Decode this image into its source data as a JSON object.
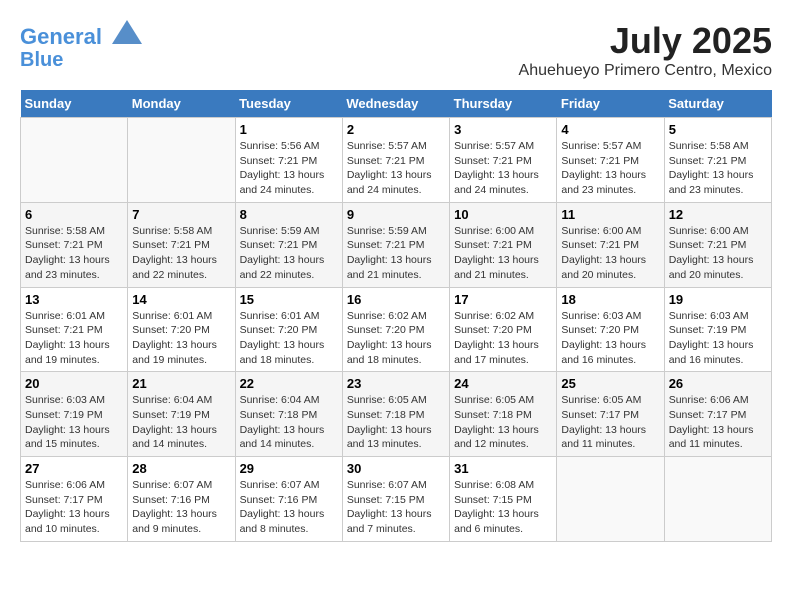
{
  "header": {
    "logo_line1": "General",
    "logo_line2": "Blue",
    "month": "July 2025",
    "location": "Ahuehueyo Primero Centro, Mexico"
  },
  "days_of_week": [
    "Sunday",
    "Monday",
    "Tuesday",
    "Wednesday",
    "Thursday",
    "Friday",
    "Saturday"
  ],
  "weeks": [
    [
      {
        "day": "",
        "info": ""
      },
      {
        "day": "",
        "info": ""
      },
      {
        "day": "1",
        "info": "Sunrise: 5:56 AM\nSunset: 7:21 PM\nDaylight: 13 hours\nand 24 minutes."
      },
      {
        "day": "2",
        "info": "Sunrise: 5:57 AM\nSunset: 7:21 PM\nDaylight: 13 hours\nand 24 minutes."
      },
      {
        "day": "3",
        "info": "Sunrise: 5:57 AM\nSunset: 7:21 PM\nDaylight: 13 hours\nand 24 minutes."
      },
      {
        "day": "4",
        "info": "Sunrise: 5:57 AM\nSunset: 7:21 PM\nDaylight: 13 hours\nand 23 minutes."
      },
      {
        "day": "5",
        "info": "Sunrise: 5:58 AM\nSunset: 7:21 PM\nDaylight: 13 hours\nand 23 minutes."
      }
    ],
    [
      {
        "day": "6",
        "info": "Sunrise: 5:58 AM\nSunset: 7:21 PM\nDaylight: 13 hours\nand 23 minutes."
      },
      {
        "day": "7",
        "info": "Sunrise: 5:58 AM\nSunset: 7:21 PM\nDaylight: 13 hours\nand 22 minutes."
      },
      {
        "day": "8",
        "info": "Sunrise: 5:59 AM\nSunset: 7:21 PM\nDaylight: 13 hours\nand 22 minutes."
      },
      {
        "day": "9",
        "info": "Sunrise: 5:59 AM\nSunset: 7:21 PM\nDaylight: 13 hours\nand 21 minutes."
      },
      {
        "day": "10",
        "info": "Sunrise: 6:00 AM\nSunset: 7:21 PM\nDaylight: 13 hours\nand 21 minutes."
      },
      {
        "day": "11",
        "info": "Sunrise: 6:00 AM\nSunset: 7:21 PM\nDaylight: 13 hours\nand 20 minutes."
      },
      {
        "day": "12",
        "info": "Sunrise: 6:00 AM\nSunset: 7:21 PM\nDaylight: 13 hours\nand 20 minutes."
      }
    ],
    [
      {
        "day": "13",
        "info": "Sunrise: 6:01 AM\nSunset: 7:21 PM\nDaylight: 13 hours\nand 19 minutes."
      },
      {
        "day": "14",
        "info": "Sunrise: 6:01 AM\nSunset: 7:20 PM\nDaylight: 13 hours\nand 19 minutes."
      },
      {
        "day": "15",
        "info": "Sunrise: 6:01 AM\nSunset: 7:20 PM\nDaylight: 13 hours\nand 18 minutes."
      },
      {
        "day": "16",
        "info": "Sunrise: 6:02 AM\nSunset: 7:20 PM\nDaylight: 13 hours\nand 18 minutes."
      },
      {
        "day": "17",
        "info": "Sunrise: 6:02 AM\nSunset: 7:20 PM\nDaylight: 13 hours\nand 17 minutes."
      },
      {
        "day": "18",
        "info": "Sunrise: 6:03 AM\nSunset: 7:20 PM\nDaylight: 13 hours\nand 16 minutes."
      },
      {
        "day": "19",
        "info": "Sunrise: 6:03 AM\nSunset: 7:19 PM\nDaylight: 13 hours\nand 16 minutes."
      }
    ],
    [
      {
        "day": "20",
        "info": "Sunrise: 6:03 AM\nSunset: 7:19 PM\nDaylight: 13 hours\nand 15 minutes."
      },
      {
        "day": "21",
        "info": "Sunrise: 6:04 AM\nSunset: 7:19 PM\nDaylight: 13 hours\nand 14 minutes."
      },
      {
        "day": "22",
        "info": "Sunrise: 6:04 AM\nSunset: 7:18 PM\nDaylight: 13 hours\nand 14 minutes."
      },
      {
        "day": "23",
        "info": "Sunrise: 6:05 AM\nSunset: 7:18 PM\nDaylight: 13 hours\nand 13 minutes."
      },
      {
        "day": "24",
        "info": "Sunrise: 6:05 AM\nSunset: 7:18 PM\nDaylight: 13 hours\nand 12 minutes."
      },
      {
        "day": "25",
        "info": "Sunrise: 6:05 AM\nSunset: 7:17 PM\nDaylight: 13 hours\nand 11 minutes."
      },
      {
        "day": "26",
        "info": "Sunrise: 6:06 AM\nSunset: 7:17 PM\nDaylight: 13 hours\nand 11 minutes."
      }
    ],
    [
      {
        "day": "27",
        "info": "Sunrise: 6:06 AM\nSunset: 7:17 PM\nDaylight: 13 hours\nand 10 minutes."
      },
      {
        "day": "28",
        "info": "Sunrise: 6:07 AM\nSunset: 7:16 PM\nDaylight: 13 hours\nand 9 minutes."
      },
      {
        "day": "29",
        "info": "Sunrise: 6:07 AM\nSunset: 7:16 PM\nDaylight: 13 hours\nand 8 minutes."
      },
      {
        "day": "30",
        "info": "Sunrise: 6:07 AM\nSunset: 7:15 PM\nDaylight: 13 hours\nand 7 minutes."
      },
      {
        "day": "31",
        "info": "Sunrise: 6:08 AM\nSunset: 7:15 PM\nDaylight: 13 hours\nand 6 minutes."
      },
      {
        "day": "",
        "info": ""
      },
      {
        "day": "",
        "info": ""
      }
    ]
  ]
}
